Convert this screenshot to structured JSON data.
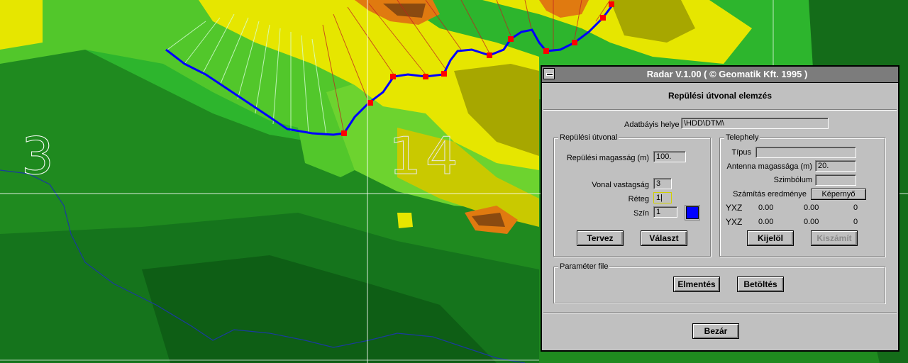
{
  "map": {
    "zone_left": "3",
    "zone_center": "14",
    "colors": {
      "low": "#1f8a1f",
      "mid": "#2db52d",
      "light": "#6dd32f",
      "yellow": "#e6e600",
      "olive": "#a7a700",
      "orange": "#e07a10",
      "brown": "#8a4a10",
      "route": "#0000ff",
      "waypoint": "#ff0000"
    }
  },
  "dialog": {
    "title": "Radar V.1.00 ( © Geomatik Kft. 1995 )",
    "heading": "Repülési útvonal elemzés",
    "database": {
      "label": "Adatbáyis helye",
      "value": "\\HDD\\DTM\\"
    },
    "route_group": {
      "title": "Repülési útvonal",
      "altitude_label": "Repülési magasság (m)",
      "altitude_value": "100.",
      "line_width_label": "Vonal vastagság",
      "line_width_value": "3",
      "layer_label": "Réteg",
      "layer_value": "1|",
      "color_label": "Szín",
      "color_value": "1",
      "swatch_color": "#0000ff",
      "plan_button": "Tervez",
      "select_button": "Választ"
    },
    "site_group": {
      "title": "Telephely",
      "type_label": "Típus",
      "type_value": "",
      "antenna_label": "Antenna magassága (m)",
      "antenna_value": "20.",
      "symbol_label": "Szimbólum",
      "symbol_value": "",
      "result_label": "Számítás eredménye",
      "result_value": "Képernyő",
      "rows": [
        {
          "label": "YXZ",
          "a": "0.00",
          "b": "0.00",
          "c": "0"
        },
        {
          "label": "YXZ",
          "a": "0.00",
          "b": "0.00",
          "c": "0"
        }
      ],
      "mark_button": "Kijelöl",
      "calc_button": "Kiszámít"
    },
    "param_group": {
      "title": "Paraméter file",
      "save_button": "Elmentés",
      "load_button": "Betöltés"
    },
    "close_button": "Bezár"
  }
}
